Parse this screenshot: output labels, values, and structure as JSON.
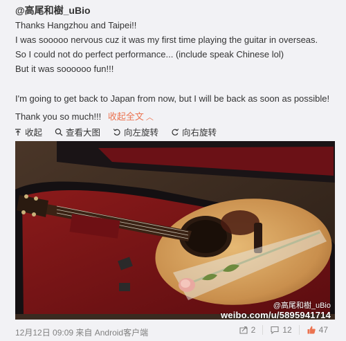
{
  "post": {
    "author": "@高尾和樹_uBio",
    "lines": [
      "Thanks Hangzhou and Taipei!!",
      "I was sooooo nervous cuz it was my first time playing the guitar in overseas.",
      "So I could not do perfect performance... (include speak Chinese lol)",
      "But it was soooooo fun!!!"
    ],
    "line_after_gap": "I'm going to get back to Japan from now, but I will be back as soon as possible!",
    "thanks": "Thank you so much!!!",
    "collapse_label": "收起全文",
    "collapse_icon": "chevron-up"
  },
  "toolbar": {
    "collapse": "收起",
    "view_large": "查看大图",
    "rotate_left": "向左旋转",
    "rotate_right": "向右旋转"
  },
  "image": {
    "watermark_user": "@高尾和樹_uBio",
    "watermark_url": "weibo.com/u/5895941714"
  },
  "footer": {
    "meta": "12月12日 09:09 来自 Android客户端",
    "repost_count": "2",
    "comment_count": "12",
    "like_count": "47"
  },
  "colors": {
    "link": "#eb7350",
    "like": "#eb7350",
    "meta": "#808080"
  }
}
